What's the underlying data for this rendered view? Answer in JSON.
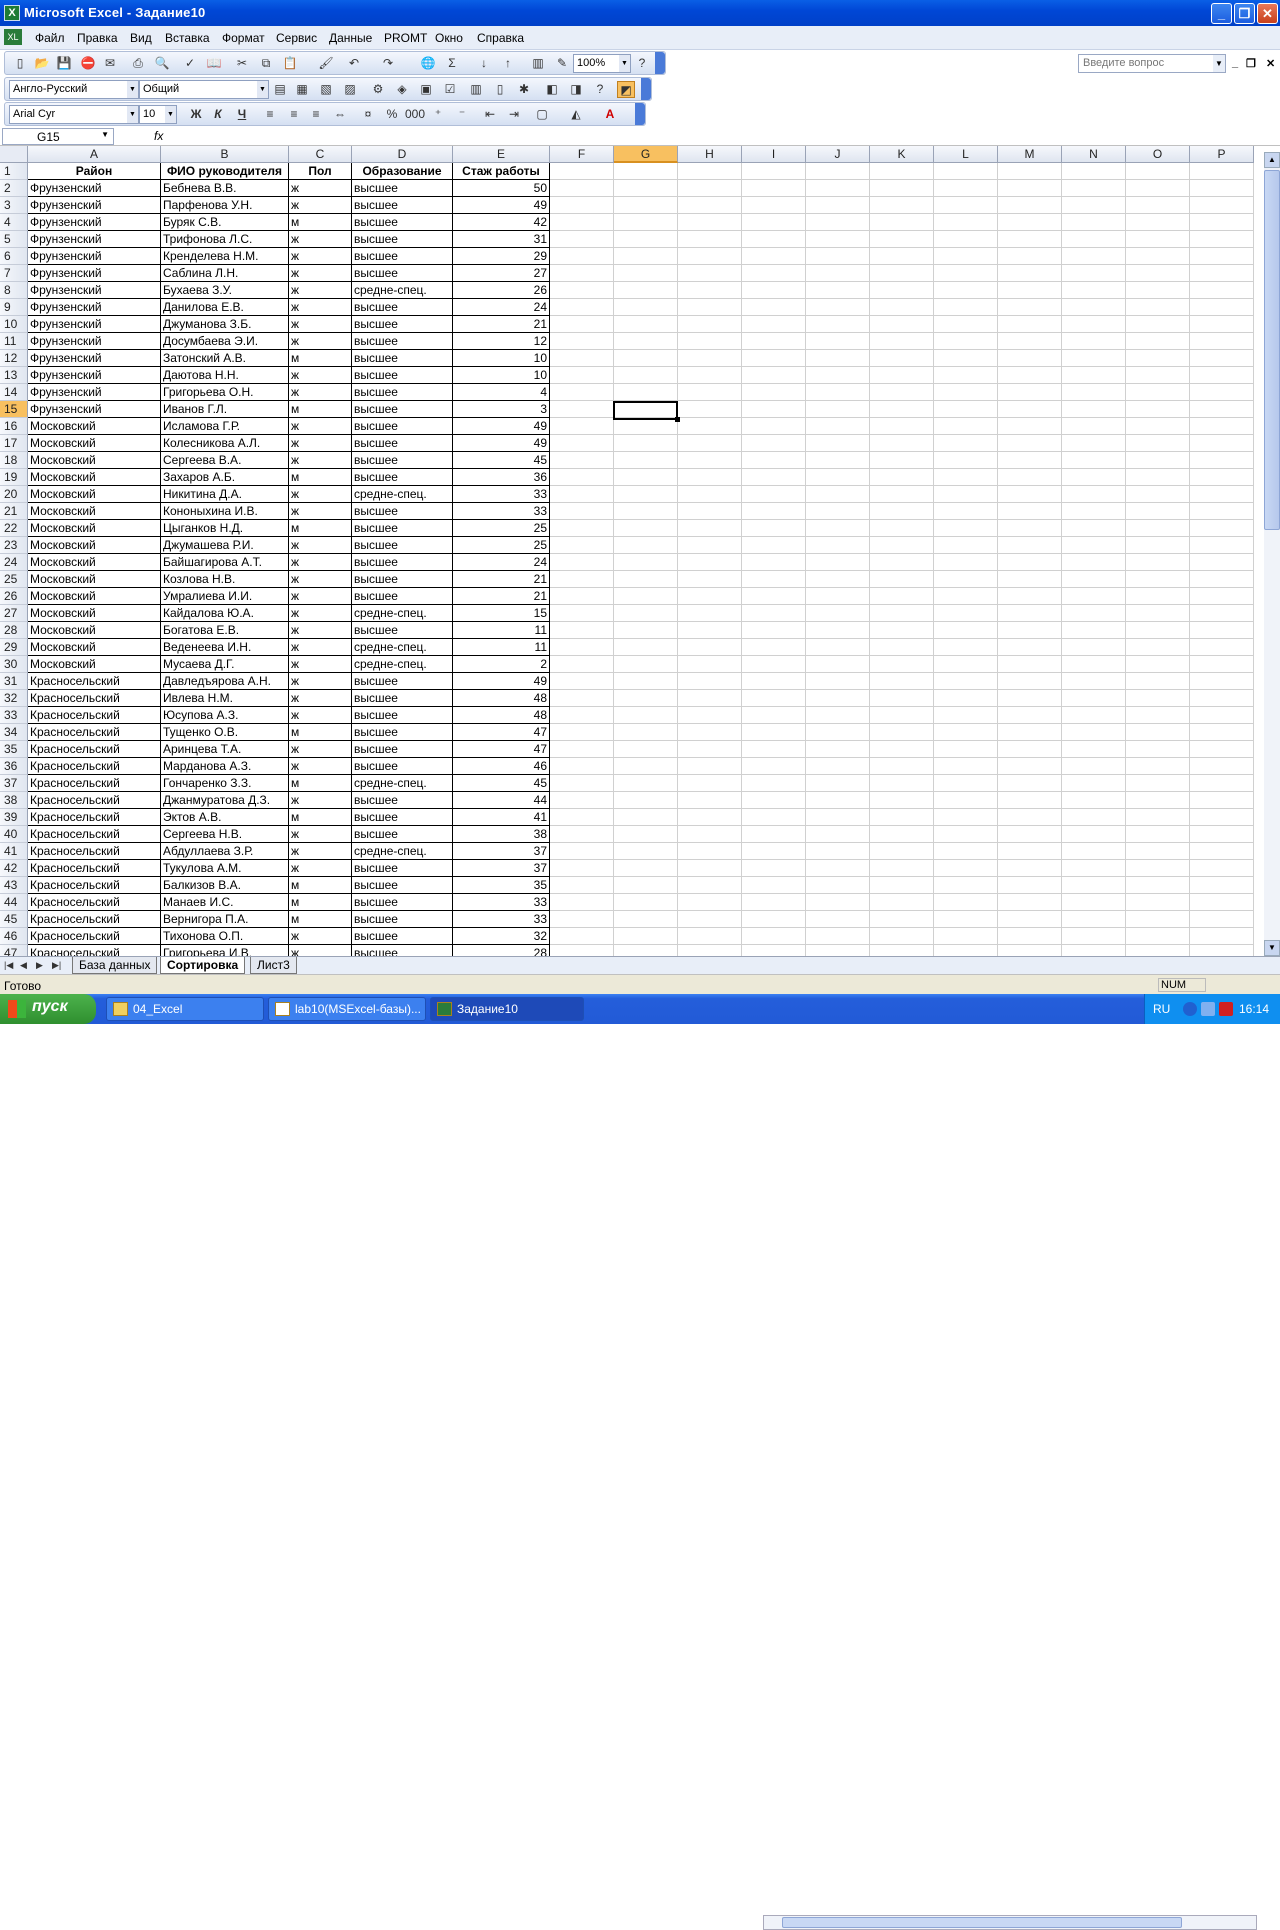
{
  "window": {
    "title": "Microsoft Excel - Задание10"
  },
  "menu": {
    "items": [
      "Файл",
      "Правка",
      "Вид",
      "Вставка",
      "Формат",
      "Сервис",
      "Данные",
      "PROMT",
      "Окно",
      "Справка"
    ],
    "question_placeholder": "Введите вопрос"
  },
  "toolbar": {
    "zoom": "100%",
    "translator": "Англо-Русский",
    "number_format": "Общий",
    "font_name": "Arial Cyr",
    "font_size": "10"
  },
  "formula_bar": {
    "name_box": "G15",
    "fx": "fx",
    "content": ""
  },
  "columns": [
    "A",
    "B",
    "C",
    "D",
    "E",
    "F",
    "G",
    "H",
    "I",
    "J",
    "K",
    "L",
    "M",
    "N",
    "O",
    "P"
  ],
  "active_cell": {
    "column": "G",
    "row": 15
  },
  "headers": [
    "Район",
    "ФИО руководителя",
    "Пол",
    "Образование",
    "Стаж работы"
  ],
  "rows": [
    [
      "Фрунзенский",
      "Бебнева В.В.",
      "ж",
      "высшее",
      50
    ],
    [
      "Фрунзенский",
      "Парфенова У.Н.",
      "ж",
      "высшее",
      49
    ],
    [
      "Фрунзенский",
      "Буряк С.В.",
      "м",
      "высшее",
      42
    ],
    [
      "Фрунзенский",
      "Трифонова Л.С.",
      "ж",
      "высшее",
      31
    ],
    [
      "Фрунзенский",
      "Кренделева Н.М.",
      "ж",
      "высшее",
      29
    ],
    [
      "Фрунзенский",
      "Саблина Л.Н.",
      "ж",
      "высшее",
      27
    ],
    [
      "Фрунзенский",
      "Бухаева З.У.",
      "ж",
      "средне-спец.",
      26
    ],
    [
      "Фрунзенский",
      "Данилова Е.В.",
      "ж",
      "высшее",
      24
    ],
    [
      "Фрунзенский",
      "Джуманова З.Б.",
      "ж",
      "высшее",
      21
    ],
    [
      "Фрунзенский",
      "Досумбаева Э.И.",
      "ж",
      "высшее",
      12
    ],
    [
      "Фрунзенский",
      "Затонский А.В.",
      "м",
      "высшее",
      10
    ],
    [
      "Фрунзенский",
      "Даютова Н.Н.",
      "ж",
      "высшее",
      10
    ],
    [
      "Фрунзенский",
      "Григорьева О.Н.",
      "ж",
      "высшее",
      4
    ],
    [
      "Фрунзенский",
      "Иванов Г.Л.",
      "м",
      "высшее",
      3
    ],
    [
      "Московский",
      "Исламова Г.Р.",
      "ж",
      "высшее",
      49
    ],
    [
      "Московский",
      "Колесникова А.Л.",
      "ж",
      "высшее",
      49
    ],
    [
      "Московский",
      "Сергеева В.А.",
      "ж",
      "высшее",
      45
    ],
    [
      "Московский",
      "Захаров А.Б.",
      "м",
      "высшее",
      36
    ],
    [
      "Московский",
      "Никитина Д.А.",
      "ж",
      "средне-спец.",
      33
    ],
    [
      "Московский",
      "Кононыхина И.В.",
      "ж",
      "высшее",
      33
    ],
    [
      "Московский",
      "Цыганков Н.Д.",
      "м",
      "высшее",
      25
    ],
    [
      "Московский",
      "Джумашева Р.И.",
      "ж",
      "высшее",
      25
    ],
    [
      "Московский",
      "Байшагирова А.Т.",
      "ж",
      "высшее",
      24
    ],
    [
      "Московский",
      "Козлова Н.В.",
      "ж",
      "высшее",
      21
    ],
    [
      "Московский",
      "Умралиева И.И.",
      "ж",
      "высшее",
      21
    ],
    [
      "Московский",
      "Кайдалова Ю.А.",
      "ж",
      "средне-спец.",
      15
    ],
    [
      "Московский",
      "Богатова Е.В.",
      "ж",
      "высшее",
      11
    ],
    [
      "Московский",
      "Веденеева И.Н.",
      "ж",
      "средне-спец.",
      11
    ],
    [
      "Московский",
      "Мусаева Д.Г.",
      "ж",
      "средне-спец.",
      2
    ],
    [
      "Красносельский",
      "Давледъярова А.Н.",
      "ж",
      "высшее",
      49
    ],
    [
      "Красносельский",
      "Ивлева Н.М.",
      "ж",
      "высшее",
      48
    ],
    [
      "Красносельский",
      "Юсупова А.З.",
      "ж",
      "высшее",
      48
    ],
    [
      "Красносельский",
      "Тущенко О.В.",
      "м",
      "высшее",
      47
    ],
    [
      "Красносельский",
      "Аринцева Т.А.",
      "ж",
      "высшее",
      47
    ],
    [
      "Красносельский",
      "Марданова А.З.",
      "ж",
      "высшее",
      46
    ],
    [
      "Красносельский",
      "Гончаренко З.З.",
      "м",
      "средне-спец.",
      45
    ],
    [
      "Красносельский",
      "Джанмуратова Д.З.",
      "ж",
      "высшее",
      44
    ],
    [
      "Красносельский",
      "Эктов А.В.",
      "м",
      "высшее",
      41
    ],
    [
      "Красносельский",
      "Сергеева Н.В.",
      "ж",
      "высшее",
      38
    ],
    [
      "Красносельский",
      "Абдуллаева З.Р.",
      "ж",
      "средне-спец.",
      37
    ],
    [
      "Красносельский",
      "Тукулова А.М.",
      "ж",
      "высшее",
      37
    ],
    [
      "Красносельский",
      "Балкизов В.А.",
      "м",
      "высшее",
      35
    ],
    [
      "Красносельский",
      "Манаев И.С.",
      "м",
      "высшее",
      33
    ],
    [
      "Красносельский",
      "Вернигора П.А.",
      "м",
      "высшее",
      33
    ],
    [
      "Красносельский",
      "Тихонова О.П.",
      "ж",
      "высшее",
      32
    ],
    [
      "Красносельский",
      "Григорьева И.В.",
      "ж",
      "высшее",
      28
    ]
  ],
  "sheets": [
    "База данных",
    "Сортировка",
    "Лист3"
  ],
  "active_sheet": "Сортировка",
  "status": {
    "text": "Готово",
    "num": "NUM"
  },
  "taskbar": {
    "start": "пуск",
    "items": [
      "04_Excel",
      "lab10(MSExcel-базы)...",
      "Задание10"
    ],
    "lang": "RU",
    "clock": "16:14"
  }
}
